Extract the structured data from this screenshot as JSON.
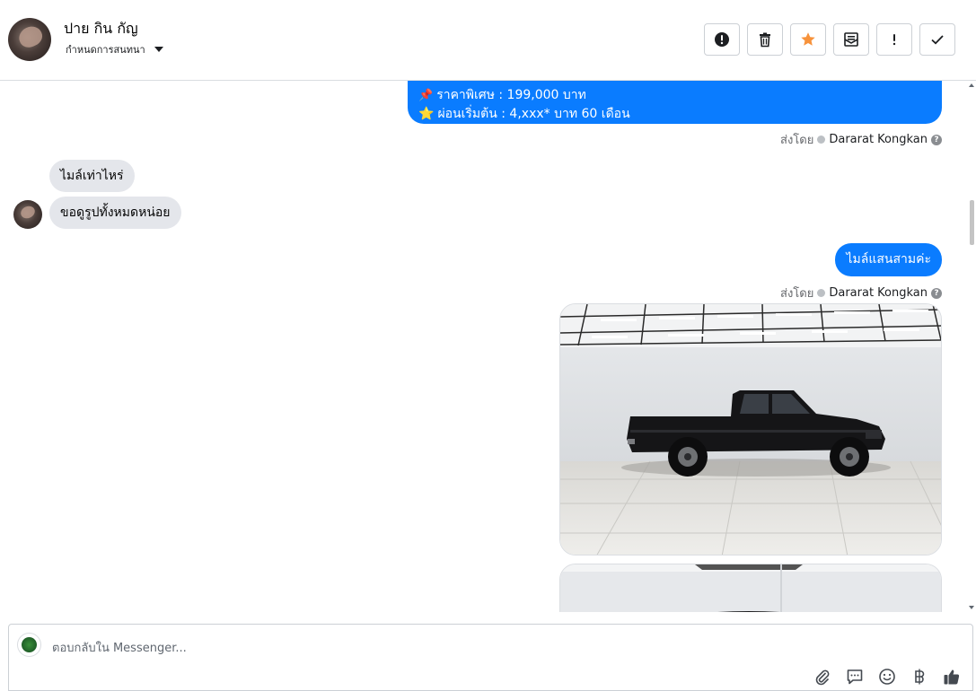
{
  "header": {
    "contact_name": "ปาย กิน กัญ",
    "assign_label": "กำหนดการสนทนา",
    "tools": [
      {
        "name": "mark-spam",
        "icon": "alert-circle-icon"
      },
      {
        "name": "delete",
        "icon": "trash-icon"
      },
      {
        "name": "star",
        "icon": "star-icon",
        "color": "#f7923b"
      },
      {
        "name": "mark-unread",
        "icon": "envelope-icon"
      },
      {
        "name": "follow-up",
        "icon": "exclamation-icon"
      },
      {
        "name": "mark-done",
        "icon": "check-icon"
      }
    ]
  },
  "messages": {
    "promo": {
      "line1": "ราคาพิเศษ : 199,000 บาท",
      "line2": "ผ่อนเริ่มต้น : 4,xxx* บาท 60 เดือน"
    },
    "sent_by_label": "ส่งโดย",
    "sender_name": "Dararat Kongkan",
    "incoming": [
      "ไมล์เท่าไหร่",
      "ขอดูรูปทั้งหมดหน่อย"
    ],
    "reply": "ไมล์แสนสามค่ะ"
  },
  "composer": {
    "placeholder": "ตอบกลับใน Messenger..."
  },
  "colors": {
    "accent_blue": "#0a7cff",
    "incoming_bubble": "#e4e6eb",
    "star_orange": "#f7923b"
  }
}
